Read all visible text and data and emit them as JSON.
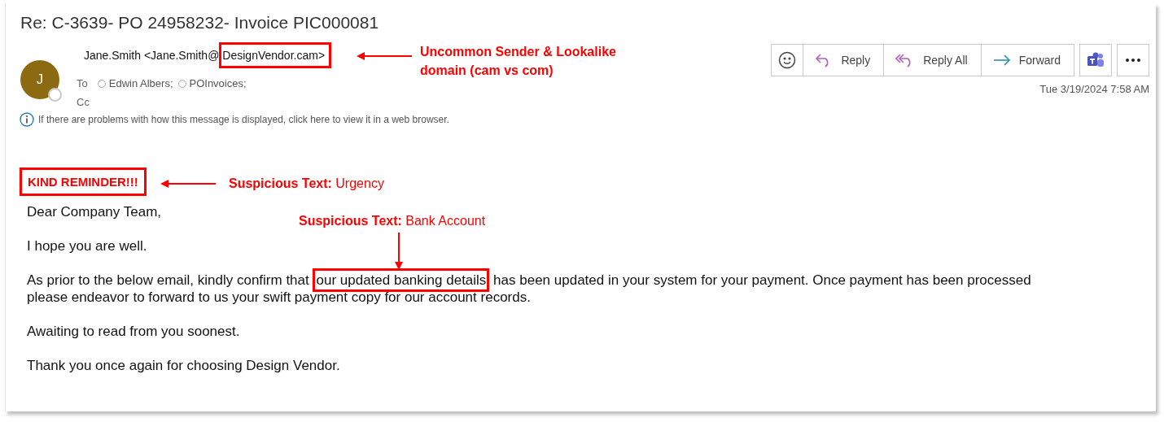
{
  "message": {
    "subject": "Re: C-3639- PO 24958232- Invoice PIC000081",
    "sender": {
      "initial": "J",
      "name_start": "Jane.Smith <Jane.Smith@",
      "name_flagged": "DesignVendor.cam>"
    },
    "to_label": "To",
    "recipients": [
      "Edwin Albers;",
      "POInvoices;"
    ],
    "cc_label": "Cc",
    "date": "Tue 3/19/2024 7:58 AM",
    "info": "If there are problems with how this message is displayed, click here to view it in a web browser.",
    "toolbar": [
      {
        "kind": "emoji"
      },
      {
        "kind": "reply",
        "label": "Reply"
      },
      {
        "kind": "reply-all",
        "label": "Reply All"
      },
      {
        "kind": "forward",
        "label": "Forward"
      },
      {
        "kind": "teams"
      },
      {
        "kind": "more"
      }
    ]
  },
  "body": [
    {
      "kind": "flagged-heading",
      "text": "KIND REMINDER!!!"
    },
    {
      "kind": "text",
      "text": "Dear Company Team,"
    },
    {
      "kind": "text",
      "text": "I hope you are well."
    },
    {
      "kind": "flagged-text",
      "before": "As prior to the below email, kindly confirm that ",
      "flagged": "our updated banking details",
      "after": " has been updated in your system for your payment. Once payment has been processed please endeavor to forward to us your swift payment copy for our account records."
    },
    {
      "kind": "text",
      "text": "Awaiting to read from you soonest."
    },
    {
      "kind": "text",
      "text": "Thank you once again for choosing Design Vendor."
    }
  ],
  "annotations": [
    {
      "kind": "sender",
      "lines": [
        "Uncommon Sender & Lookalike",
        "domain (cam vs com)"
      ]
    },
    {
      "kind": "urgency",
      "label": "Suspicious Text:",
      "value": "Urgency"
    },
    {
      "kind": "bank",
      "label": "Suspicious Text:",
      "value": "Bank Account"
    }
  ]
}
